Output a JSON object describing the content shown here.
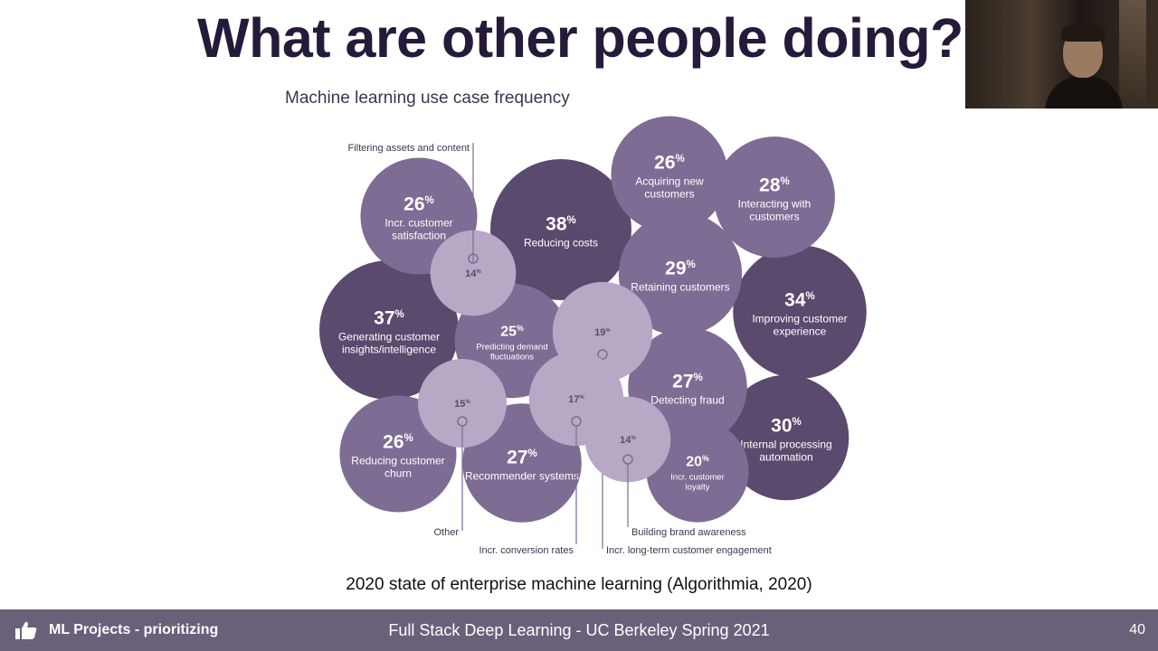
{
  "slide": {
    "title": "What are other people doing?",
    "caption": "2020 state of enterprise machine learning (Algorithmia, 2020)"
  },
  "footer": {
    "project": "ML Projects - prioritizing",
    "course": "Full Stack Deep Learning - UC Berkeley Spring 2021",
    "page_number": "40",
    "icon": "thumbs-up-icon"
  },
  "webcam": {
    "description": "presenter video feed"
  },
  "chart_data": {
    "type": "bubble",
    "title": "Machine learning use case frequency",
    "unit": "%",
    "colors": {
      "high": "#5a4a6e",
      "mid": "#7d6c94",
      "low": "#b7a8c6",
      "external_label": "#3d3550"
    },
    "bubbles": [
      {
        "value": 38,
        "label": "Reducing costs",
        "labeled_outside": false
      },
      {
        "value": 37,
        "label": "Generating customer insights/intelligence",
        "labeled_outside": false
      },
      {
        "value": 34,
        "label": "Improving customer experience",
        "labeled_outside": false
      },
      {
        "value": 30,
        "label": "Internal processing automation",
        "labeled_outside": false
      },
      {
        "value": 29,
        "label": "Retaining customers",
        "labeled_outside": false
      },
      {
        "value": 28,
        "label": "Interacting with customers",
        "labeled_outside": false
      },
      {
        "value": 27,
        "label": "Detecting fraud",
        "labeled_outside": false
      },
      {
        "value": 27,
        "label": "Recommender systems",
        "labeled_outside": false
      },
      {
        "value": 26,
        "label": "Incr. customer satisfaction",
        "labeled_outside": false
      },
      {
        "value": 26,
        "label": "Acquiring new customers",
        "labeled_outside": false
      },
      {
        "value": 26,
        "label": "Reducing customer churn",
        "labeled_outside": false
      },
      {
        "value": 25,
        "label": "Predicting demand fluctuations",
        "labeled_outside": false
      },
      {
        "value": 20,
        "label": "Incr. customer loyalty",
        "labeled_outside": false
      },
      {
        "value": 19,
        "label": "Incr. long-term customer engagement",
        "labeled_outside": true
      },
      {
        "value": 17,
        "label": "Incr. conversion rates",
        "labeled_outside": true
      },
      {
        "value": 15,
        "label": "Other",
        "labeled_outside": true
      },
      {
        "value": 14,
        "label": "Filtering assets and content",
        "labeled_outside": true
      },
      {
        "value": 14,
        "label": "Building brand awareness",
        "labeled_outside": true
      }
    ]
  }
}
